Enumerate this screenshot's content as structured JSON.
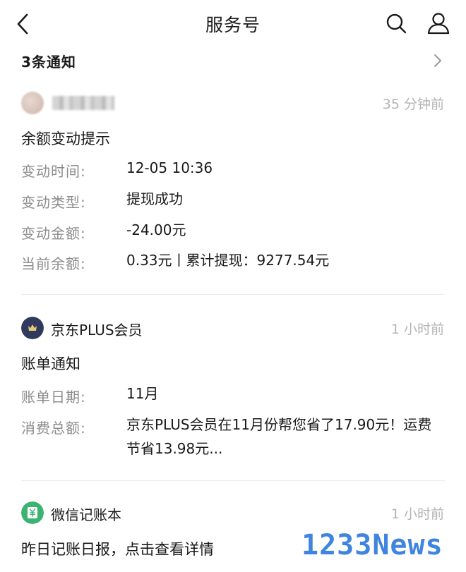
{
  "header": {
    "title": "服务号"
  },
  "notice": {
    "label": "3条通知"
  },
  "messages": [
    {
      "sender": "",
      "time": "35 分钟前",
      "title": "余额变动提示",
      "fields": [
        {
          "key": "变动时间:",
          "value": "12-05 10:36"
        },
        {
          "key": "变动类型:",
          "value": "提现成功"
        },
        {
          "key": "变动金额:",
          "value": "-24.00元"
        },
        {
          "key": "当前余额:",
          "value": "0.33元丨累计提现：9277.54元"
        }
      ]
    },
    {
      "sender": "京东PLUS会员",
      "time": "1 小时前",
      "title": "账单通知",
      "fields": [
        {
          "key": "账单日期:",
          "value": "11月"
        },
        {
          "key": "消费总额:",
          "value": "京东PLUS会员在11月份帮您省了17.90元！运费节省13.98元..."
        }
      ]
    },
    {
      "sender": "微信记账本",
      "time": "1 小时前",
      "title": "昨日记账日报，点击查看详情"
    }
  ],
  "watermark": "1233News",
  "colors": {
    "muted": "#8c8c8c",
    "time": "#b4b4b4",
    "jd_badge": "#2f3a5c",
    "ledger_green": "#3cb371",
    "watermark": "#1e6fd9"
  }
}
